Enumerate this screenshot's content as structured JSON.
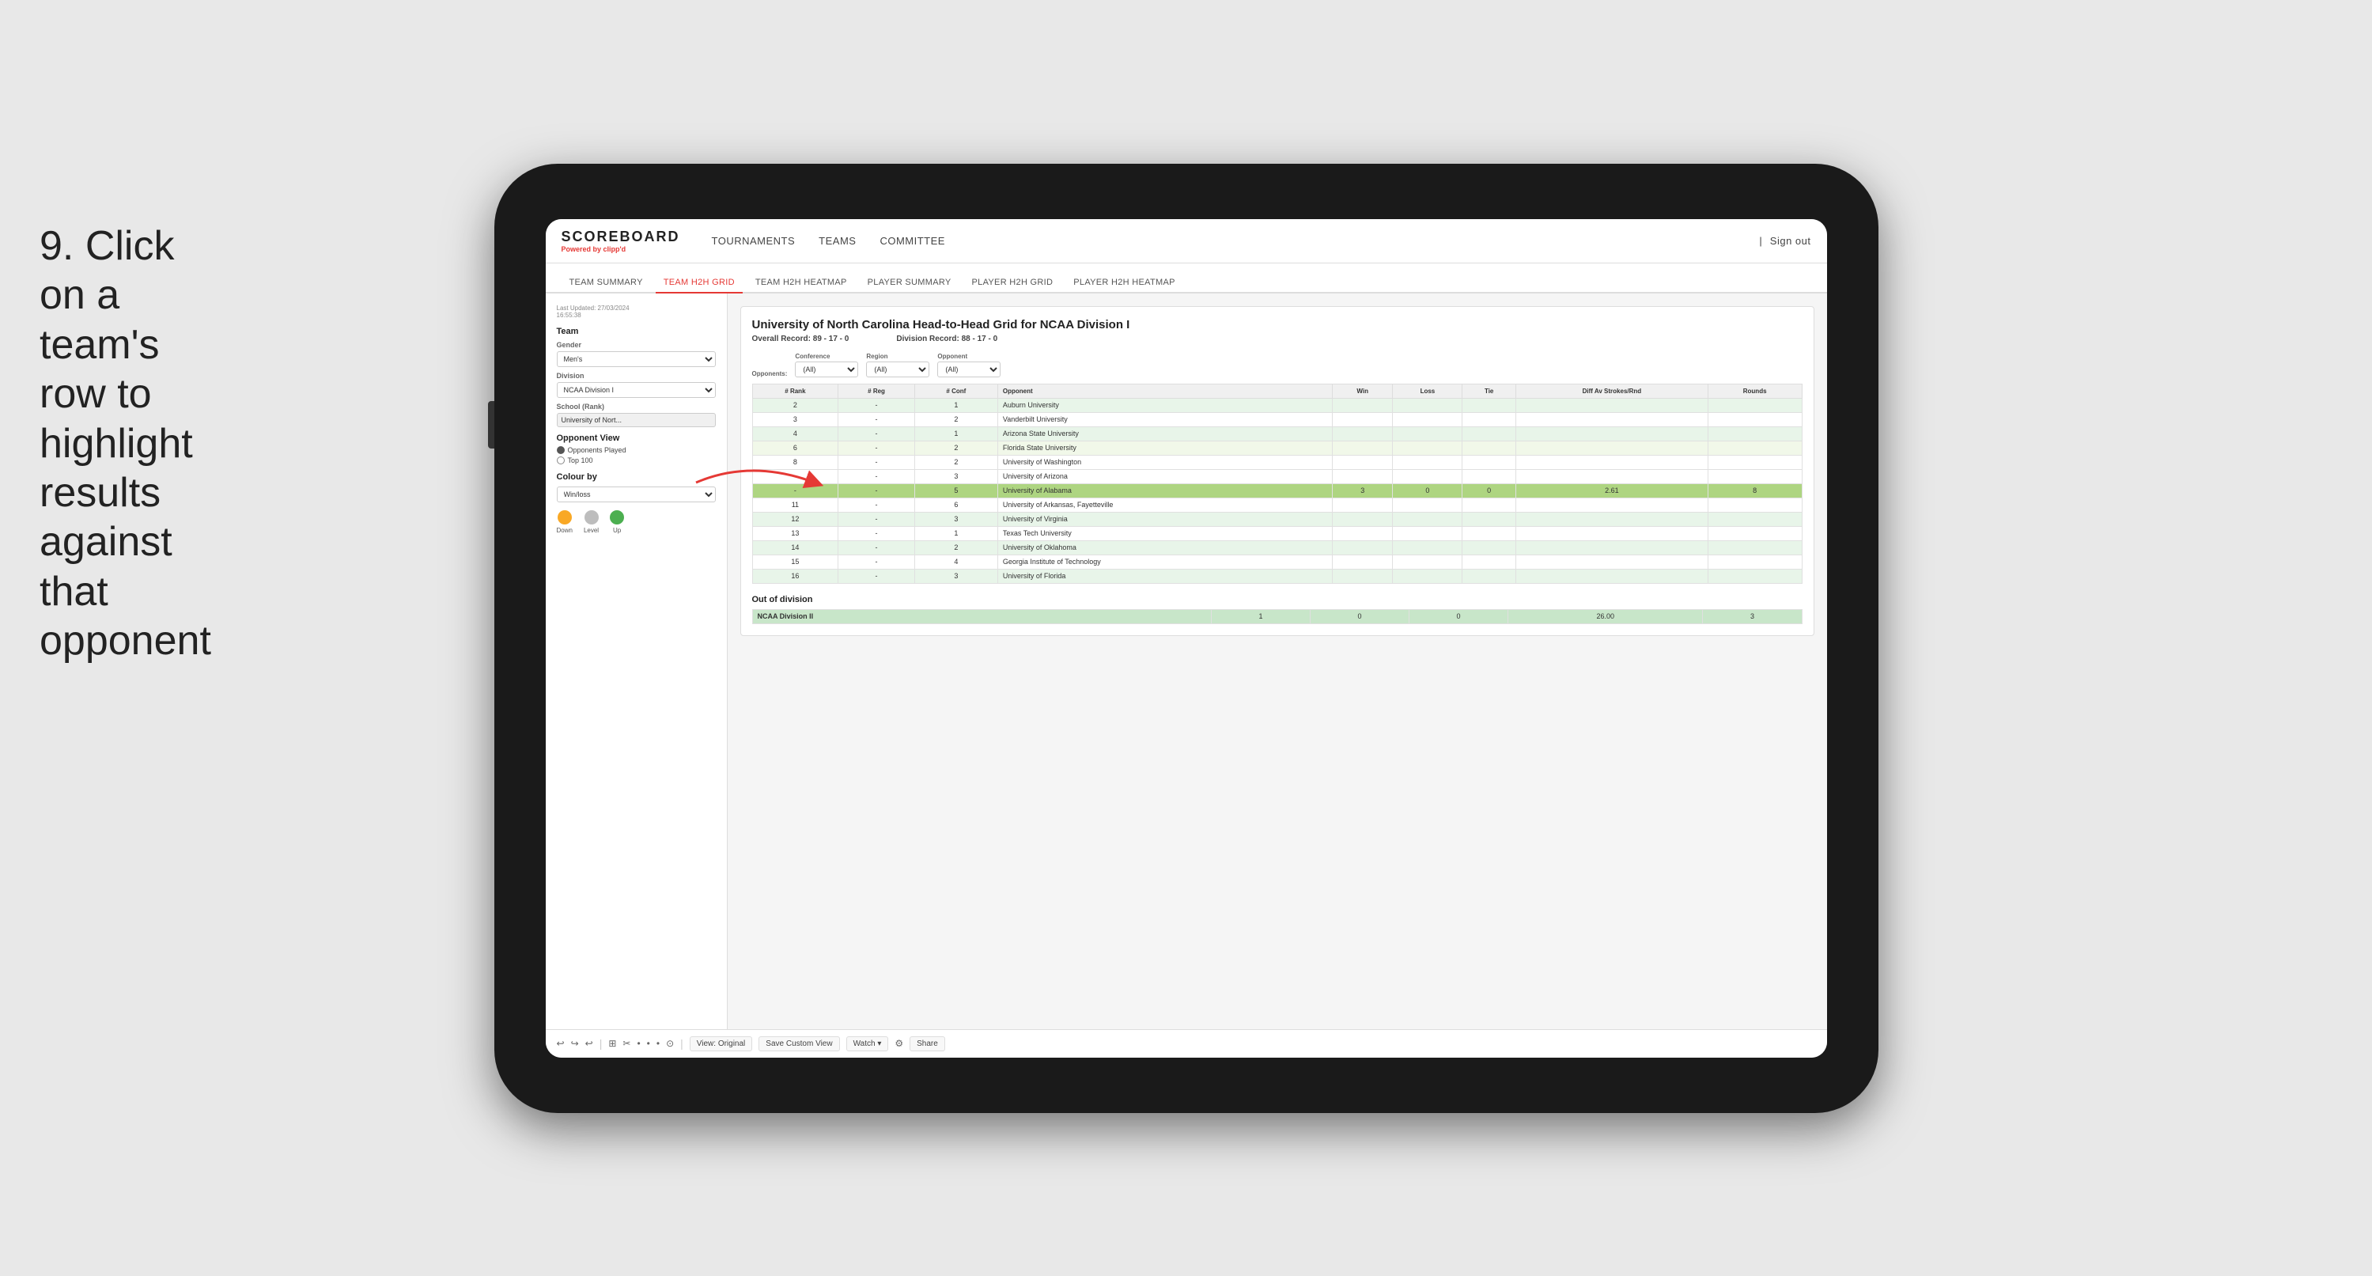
{
  "instruction": {
    "step": "9.",
    "text": "Click on a team's row to highlight results against that opponent"
  },
  "navbar": {
    "logo": "SCOREBOARD",
    "logo_sub": "Powered by",
    "logo_brand": "clipp'd",
    "links": [
      "TOURNAMENTS",
      "TEAMS",
      "COMMITTEE"
    ],
    "sign_in_sep": "|",
    "sign_out": "Sign out"
  },
  "subnav": {
    "items": [
      "TEAM SUMMARY",
      "TEAM H2H GRID",
      "TEAM H2H HEATMAP",
      "PLAYER SUMMARY",
      "PLAYER H2H GRID",
      "PLAYER H2H HEATMAP"
    ],
    "active": "TEAM H2H GRID"
  },
  "left_panel": {
    "last_updated_label": "Last Updated: 27/03/2024",
    "time": "16:55:38",
    "team_label": "Team",
    "gender_label": "Gender",
    "gender_value": "Men's",
    "division_label": "Division",
    "division_value": "NCAA Division I",
    "school_label": "School (Rank)",
    "school_value": "University of Nort...",
    "opponent_view_label": "Opponent View",
    "radio_options": [
      "Opponents Played",
      "Top 100"
    ],
    "radio_selected": "Opponents Played",
    "colour_label": "Colour by",
    "colour_value": "Win/loss",
    "legend": [
      {
        "label": "Down",
        "color": "#f9a825"
      },
      {
        "label": "Level",
        "color": "#bdbdbd"
      },
      {
        "label": "Up",
        "color": "#4caf50"
      }
    ]
  },
  "grid": {
    "title": "University of North Carolina Head-to-Head Grid for NCAA Division I",
    "overall_record_label": "Overall Record:",
    "overall_record": "89 - 17 - 0",
    "division_record_label": "Division Record:",
    "division_record": "88 - 17 - 0",
    "filters": {
      "opponents_label": "Opponents:",
      "conference_label": "Conference",
      "conference_value": "(All)",
      "region_label": "Region",
      "region_value": "(All)",
      "opponent_label": "Opponent",
      "opponent_value": "(All)"
    },
    "table_headers": [
      "# Rank",
      "# Reg",
      "# Conf",
      "Opponent",
      "Win",
      "Loss",
      "Tie",
      "Diff Av Strokes/Rnd",
      "Rounds"
    ],
    "rows": [
      {
        "rank": "2",
        "reg": "-",
        "conf": "1",
        "opponent": "Auburn University",
        "win": "",
        "loss": "",
        "tie": "",
        "diff": "",
        "rounds": "",
        "style": "light-green"
      },
      {
        "rank": "3",
        "reg": "-",
        "conf": "2",
        "opponent": "Vanderbilt University",
        "win": "",
        "loss": "",
        "tie": "",
        "diff": "",
        "rounds": "",
        "style": "white"
      },
      {
        "rank": "4",
        "reg": "-",
        "conf": "1",
        "opponent": "Arizona State University",
        "win": "",
        "loss": "",
        "tie": "",
        "diff": "",
        "rounds": "",
        "style": "light-green"
      },
      {
        "rank": "6",
        "reg": "-",
        "conf": "2",
        "opponent": "Florida State University",
        "win": "",
        "loss": "",
        "tie": "",
        "diff": "",
        "rounds": "",
        "style": "yellow-green"
      },
      {
        "rank": "8",
        "reg": "-",
        "conf": "2",
        "opponent": "University of Washington",
        "win": "",
        "loss": "",
        "tie": "",
        "diff": "",
        "rounds": "",
        "style": "white"
      },
      {
        "rank": "-",
        "reg": "-",
        "conf": "3",
        "opponent": "University of Arizona",
        "win": "",
        "loss": "",
        "tie": "",
        "diff": "",
        "rounds": "",
        "style": "white"
      },
      {
        "rank": "-",
        "reg": "-",
        "conf": "5",
        "opponent": "University of Alabama",
        "win": "3",
        "loss": "0",
        "tie": "0",
        "diff": "2.61",
        "rounds": "8",
        "style": "highlighted"
      },
      {
        "rank": "11",
        "reg": "-",
        "conf": "6",
        "opponent": "University of Arkansas, Fayetteville",
        "win": "",
        "loss": "",
        "tie": "",
        "diff": "",
        "rounds": "",
        "style": "white"
      },
      {
        "rank": "12",
        "reg": "-",
        "conf": "3",
        "opponent": "University of Virginia",
        "win": "",
        "loss": "",
        "tie": "",
        "diff": "",
        "rounds": "",
        "style": "light-green"
      },
      {
        "rank": "13",
        "reg": "-",
        "conf": "1",
        "opponent": "Texas Tech University",
        "win": "",
        "loss": "",
        "tie": "",
        "diff": "",
        "rounds": "",
        "style": "white"
      },
      {
        "rank": "14",
        "reg": "-",
        "conf": "2",
        "opponent": "University of Oklahoma",
        "win": "",
        "loss": "",
        "tie": "",
        "diff": "",
        "rounds": "",
        "style": "light-green"
      },
      {
        "rank": "15",
        "reg": "-",
        "conf": "4",
        "opponent": "Georgia Institute of Technology",
        "win": "",
        "loss": "",
        "tie": "",
        "diff": "",
        "rounds": "",
        "style": "white"
      },
      {
        "rank": "16",
        "reg": "-",
        "conf": "3",
        "opponent": "University of Florida",
        "win": "",
        "loss": "",
        "tie": "",
        "diff": "",
        "rounds": "",
        "style": "light-green"
      }
    ],
    "out_of_division_label": "Out of division",
    "out_of_division_rows": [
      {
        "name": "NCAA Division II",
        "win": "1",
        "loss": "0",
        "tie": "0",
        "diff": "26.00",
        "rounds": "3",
        "style": "green"
      }
    ]
  },
  "toolbar": {
    "buttons": [
      "⟲",
      "⟳",
      "↩",
      "⊞",
      "✂",
      "·",
      "·",
      "·",
      "⊙"
    ],
    "view_original": "View: Original",
    "save_custom": "Save Custom View",
    "watch": "Watch ▾",
    "share": "Share"
  }
}
